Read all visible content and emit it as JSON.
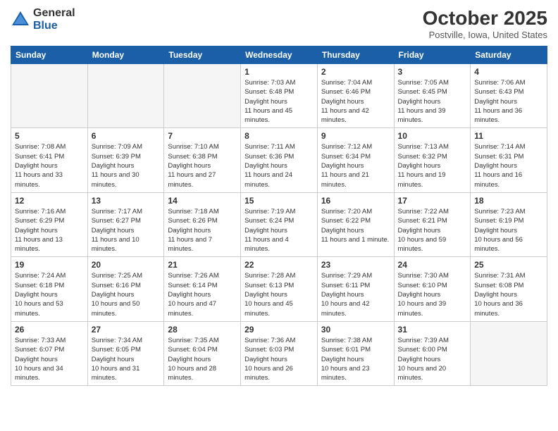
{
  "header": {
    "logo_general": "General",
    "logo_blue": "Blue",
    "month_title": "October 2025",
    "location": "Postville, Iowa, United States"
  },
  "days_of_week": [
    "Sunday",
    "Monday",
    "Tuesday",
    "Wednesday",
    "Thursday",
    "Friday",
    "Saturday"
  ],
  "weeks": [
    [
      {
        "day": "",
        "empty": true
      },
      {
        "day": "",
        "empty": true
      },
      {
        "day": "",
        "empty": true
      },
      {
        "day": "1",
        "sunrise": "7:03 AM",
        "sunset": "6:48 PM",
        "daylight": "11 hours and 45 minutes."
      },
      {
        "day": "2",
        "sunrise": "7:04 AM",
        "sunset": "6:46 PM",
        "daylight": "11 hours and 42 minutes."
      },
      {
        "day": "3",
        "sunrise": "7:05 AM",
        "sunset": "6:45 PM",
        "daylight": "11 hours and 39 minutes."
      },
      {
        "day": "4",
        "sunrise": "7:06 AM",
        "sunset": "6:43 PM",
        "daylight": "11 hours and 36 minutes."
      }
    ],
    [
      {
        "day": "5",
        "sunrise": "7:08 AM",
        "sunset": "6:41 PM",
        "daylight": "11 hours and 33 minutes."
      },
      {
        "day": "6",
        "sunrise": "7:09 AM",
        "sunset": "6:39 PM",
        "daylight": "11 hours and 30 minutes."
      },
      {
        "day": "7",
        "sunrise": "7:10 AM",
        "sunset": "6:38 PM",
        "daylight": "11 hours and 27 minutes."
      },
      {
        "day": "8",
        "sunrise": "7:11 AM",
        "sunset": "6:36 PM",
        "daylight": "11 hours and 24 minutes."
      },
      {
        "day": "9",
        "sunrise": "7:12 AM",
        "sunset": "6:34 PM",
        "daylight": "11 hours and 21 minutes."
      },
      {
        "day": "10",
        "sunrise": "7:13 AM",
        "sunset": "6:32 PM",
        "daylight": "11 hours and 19 minutes."
      },
      {
        "day": "11",
        "sunrise": "7:14 AM",
        "sunset": "6:31 PM",
        "daylight": "11 hours and 16 minutes."
      }
    ],
    [
      {
        "day": "12",
        "sunrise": "7:16 AM",
        "sunset": "6:29 PM",
        "daylight": "11 hours and 13 minutes."
      },
      {
        "day": "13",
        "sunrise": "7:17 AM",
        "sunset": "6:27 PM",
        "daylight": "11 hours and 10 minutes."
      },
      {
        "day": "14",
        "sunrise": "7:18 AM",
        "sunset": "6:26 PM",
        "daylight": "11 hours and 7 minutes."
      },
      {
        "day": "15",
        "sunrise": "7:19 AM",
        "sunset": "6:24 PM",
        "daylight": "11 hours and 4 minutes."
      },
      {
        "day": "16",
        "sunrise": "7:20 AM",
        "sunset": "6:22 PM",
        "daylight": "11 hours and 1 minute."
      },
      {
        "day": "17",
        "sunrise": "7:22 AM",
        "sunset": "6:21 PM",
        "daylight": "10 hours and 59 minutes."
      },
      {
        "day": "18",
        "sunrise": "7:23 AM",
        "sunset": "6:19 PM",
        "daylight": "10 hours and 56 minutes."
      }
    ],
    [
      {
        "day": "19",
        "sunrise": "7:24 AM",
        "sunset": "6:18 PM",
        "daylight": "10 hours and 53 minutes."
      },
      {
        "day": "20",
        "sunrise": "7:25 AM",
        "sunset": "6:16 PM",
        "daylight": "10 hours and 50 minutes."
      },
      {
        "day": "21",
        "sunrise": "7:26 AM",
        "sunset": "6:14 PM",
        "daylight": "10 hours and 47 minutes."
      },
      {
        "day": "22",
        "sunrise": "7:28 AM",
        "sunset": "6:13 PM",
        "daylight": "10 hours and 45 minutes."
      },
      {
        "day": "23",
        "sunrise": "7:29 AM",
        "sunset": "6:11 PM",
        "daylight": "10 hours and 42 minutes."
      },
      {
        "day": "24",
        "sunrise": "7:30 AM",
        "sunset": "6:10 PM",
        "daylight": "10 hours and 39 minutes."
      },
      {
        "day": "25",
        "sunrise": "7:31 AM",
        "sunset": "6:08 PM",
        "daylight": "10 hours and 36 minutes."
      }
    ],
    [
      {
        "day": "26",
        "sunrise": "7:33 AM",
        "sunset": "6:07 PM",
        "daylight": "10 hours and 34 minutes."
      },
      {
        "day": "27",
        "sunrise": "7:34 AM",
        "sunset": "6:05 PM",
        "daylight": "10 hours and 31 minutes."
      },
      {
        "day": "28",
        "sunrise": "7:35 AM",
        "sunset": "6:04 PM",
        "daylight": "10 hours and 28 minutes."
      },
      {
        "day": "29",
        "sunrise": "7:36 AM",
        "sunset": "6:03 PM",
        "daylight": "10 hours and 26 minutes."
      },
      {
        "day": "30",
        "sunrise": "7:38 AM",
        "sunset": "6:01 PM",
        "daylight": "10 hours and 23 minutes."
      },
      {
        "day": "31",
        "sunrise": "7:39 AM",
        "sunset": "6:00 PM",
        "daylight": "10 hours and 20 minutes."
      },
      {
        "day": "",
        "empty": true
      }
    ]
  ]
}
